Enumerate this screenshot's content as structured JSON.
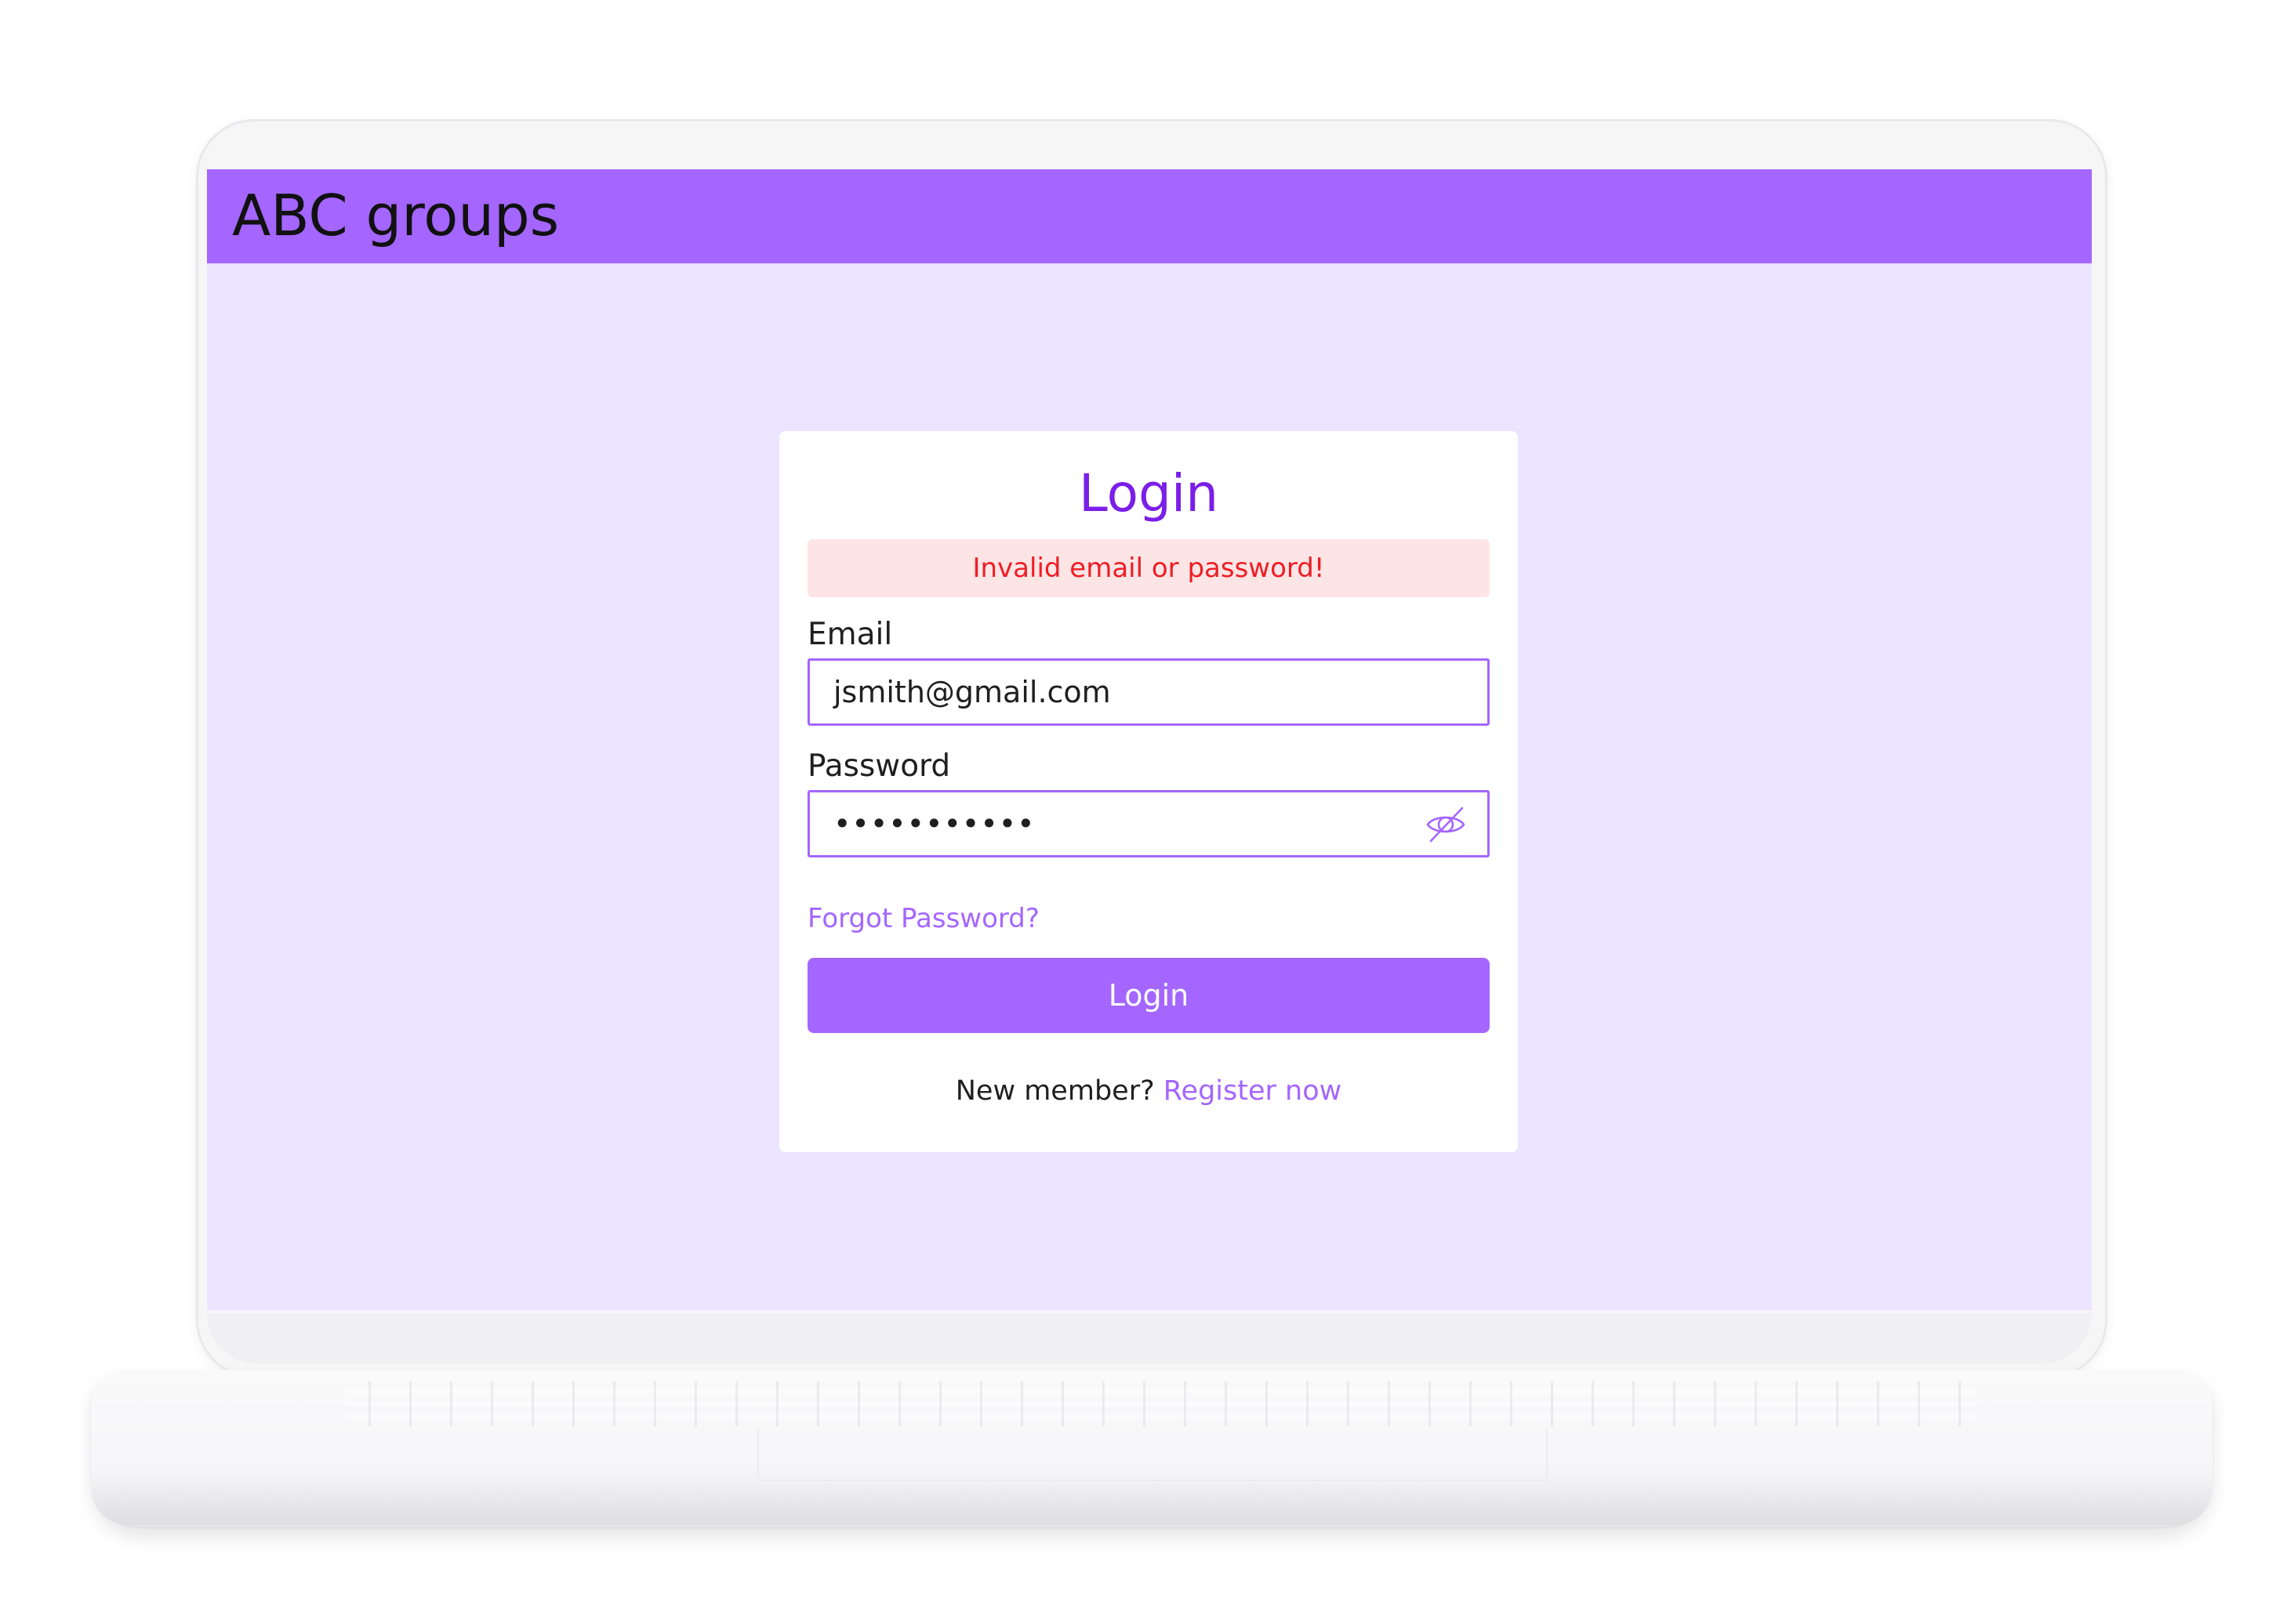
{
  "app": {
    "title": "ABC groups",
    "accent_color": "#a466ff",
    "background_color": "#ebe5ff"
  },
  "login_card": {
    "title": "Login",
    "error_message": "Invalid email or password!",
    "email": {
      "label": "Email",
      "value": "jsmith@gmail.com"
    },
    "password": {
      "label": "Password",
      "masked_value": "•••••••••••",
      "toggle_icon": "eye-slash-icon"
    },
    "forgot_password_link": "Forgot Password?",
    "login_button_label": "Login",
    "register_prompt": "New member?",
    "register_link": "Register now"
  }
}
